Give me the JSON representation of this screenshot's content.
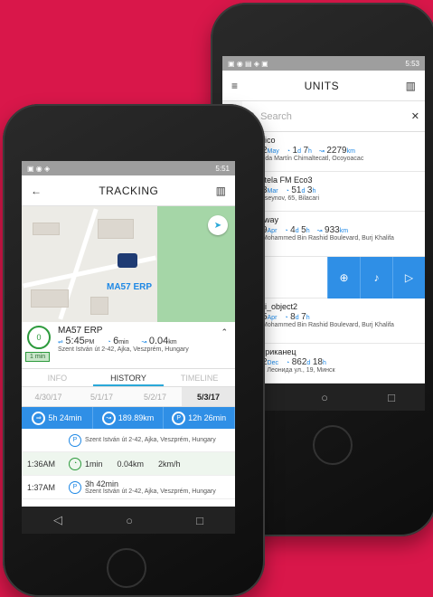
{
  "back_phone": {
    "status_time": "5:53",
    "title": "UNITS",
    "search_placeholder": "Search",
    "units": [
      {
        "badge": "12",
        "name": "Mexico",
        "date": "02",
        "date_unit": "May",
        "dur_a": "1",
        "dur_a_unit": "d",
        "dur_b": "7",
        "dur_b_unit": "h",
        "dist": "2279",
        "dist_unit": "km",
        "address": "Avenida Martín Chimaltecatl, Ocoyoacac"
      },
      {
        "badge": "",
        "name": "Ruptela FM Eco3",
        "date": "13",
        "date_unit": "Mar",
        "dur_a": "51",
        "dur_a_unit": "d",
        "dur_b": "3",
        "dur_b_unit": "h",
        "dist": "",
        "dist_unit": "",
        "address": "V. Huseynov, 65, Bilacari"
      },
      {
        "badge": "0",
        "name": "Segway",
        "date": "29",
        "date_unit": "Apr",
        "dur_a": "4",
        "dur_a_unit": "d",
        "dur_b": "5",
        "dur_b_unit": "h",
        "dist": "933",
        "dist_unit": "km",
        "address": "Shk Mohammed Bin Rashid Boulevard, Burj Khalifa"
      },
      {
        "badge": "P",
        "name": "yami_object2",
        "date": "25",
        "date_unit": "Apr",
        "dur_a": "8",
        "dur_a_unit": "d",
        "dur_b": "7",
        "dur_b_unit": "h",
        "dist": "",
        "dist_unit": "",
        "address": "Shk Mohammed Bin Rashid Boulevard, Burj Khalifa"
      },
      {
        "badge": "P",
        "name": "Американец",
        "date": "22",
        "date_unit": "Dec",
        "dur_a": "862",
        "dur_a_unit": "d",
        "dur_b": "18",
        "dur_b_unit": "h",
        "dist": "",
        "dist_unit": "",
        "address": "Беды Леонида ул., 19, Минск"
      }
    ]
  },
  "front_phone": {
    "status_time": "5:51",
    "title": "TRACKING",
    "map_label": "MA57 ERP",
    "unit": {
      "badge": "0",
      "pill": "1 min",
      "name": "MA57 ERP",
      "time": "5:45",
      "time_unit": "PM",
      "ago": "6",
      "ago_unit": "min",
      "dist": "0.04",
      "dist_unit": "km",
      "address": "Szent István út 2-42, Ajka, Veszprém, Hungary"
    },
    "tabs": [
      "INFO",
      "HISTORY",
      "TIMELINE"
    ],
    "dates": [
      "4/30/17",
      "5/1/17",
      "5/2/17",
      "5/3/17"
    ],
    "summary": {
      "moving": "5h 24min",
      "distance": "189.89km",
      "parking": "12h 26min"
    },
    "history": [
      {
        "time": "",
        "icon": "P",
        "text": "Szent István út 2-42, Ajka, Veszprém, Hungary"
      },
      {
        "time": "1:36AM",
        "icon": "◔",
        "dur": "1min",
        "dist": "0.04km",
        "speed": "2km/h"
      },
      {
        "time": "1:37AM",
        "icon": "P",
        "text": "3h 42min",
        "sub": "Szent István út 2-42, Ajka, Veszprém, Hungary"
      }
    ]
  }
}
